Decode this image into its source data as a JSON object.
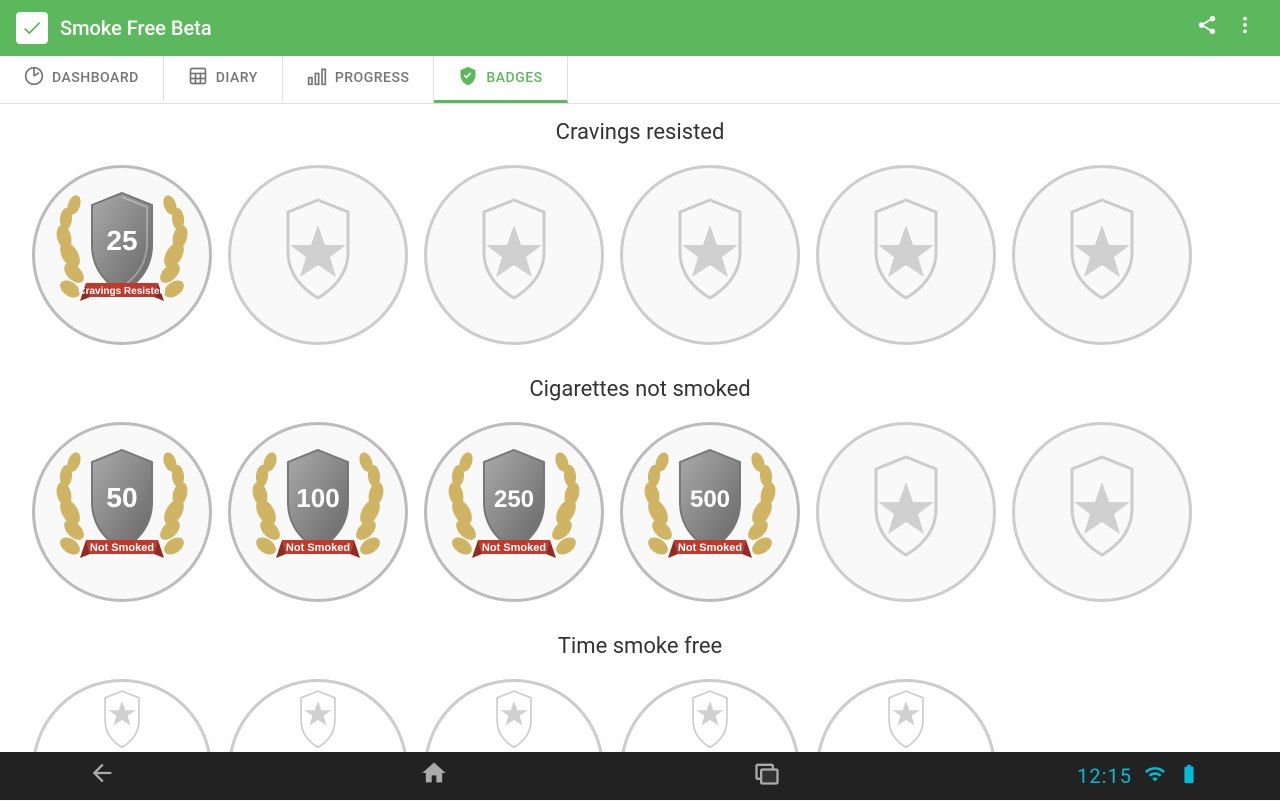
{
  "appBar": {
    "title": "Smoke Free Beta",
    "shareIcon": "⋮",
    "menuIcon": "⋮"
  },
  "navTabs": [
    {
      "id": "dashboard",
      "label": "DASHBOARD",
      "icon": "⏱",
      "active": false
    },
    {
      "id": "diary",
      "label": "DIARY",
      "icon": "⊞",
      "active": false
    },
    {
      "id": "progress",
      "label": "PROGRESS",
      "icon": "📊",
      "active": false
    },
    {
      "id": "badges",
      "label": "BADGES",
      "icon": "🛡",
      "active": true
    }
  ],
  "sections": [
    {
      "id": "cravings",
      "title": "Cravings resisted",
      "badges": [
        {
          "earned": true,
          "number": "25",
          "label": "Cravings Resisted"
        },
        {
          "earned": false
        },
        {
          "earned": false
        },
        {
          "earned": false
        },
        {
          "earned": false
        },
        {
          "earned": false
        }
      ]
    },
    {
      "id": "notsmoked",
      "title": "Cigarettes not smoked",
      "badges": [
        {
          "earned": true,
          "number": "50",
          "label": "Not Smoked"
        },
        {
          "earned": true,
          "number": "100",
          "label": "Not Smoked"
        },
        {
          "earned": true,
          "number": "250",
          "label": "Not Smoked"
        },
        {
          "earned": true,
          "number": "500",
          "label": "Not Smoked"
        },
        {
          "earned": false
        },
        {
          "earned": false
        }
      ]
    },
    {
      "id": "timefree",
      "title": "Time smoke free",
      "badges": [
        {
          "earned": false,
          "partial": true
        },
        {
          "earned": false,
          "partial": true
        },
        {
          "earned": false,
          "partial": true
        },
        {
          "earned": false,
          "partial": true
        },
        {
          "earned": false,
          "partial": true
        }
      ]
    }
  ],
  "bottomNav": {
    "backIcon": "←",
    "homeIcon": "⌂",
    "recentIcon": "▭",
    "clock": "12:15",
    "wifi": "wifi",
    "battery": "battery"
  }
}
